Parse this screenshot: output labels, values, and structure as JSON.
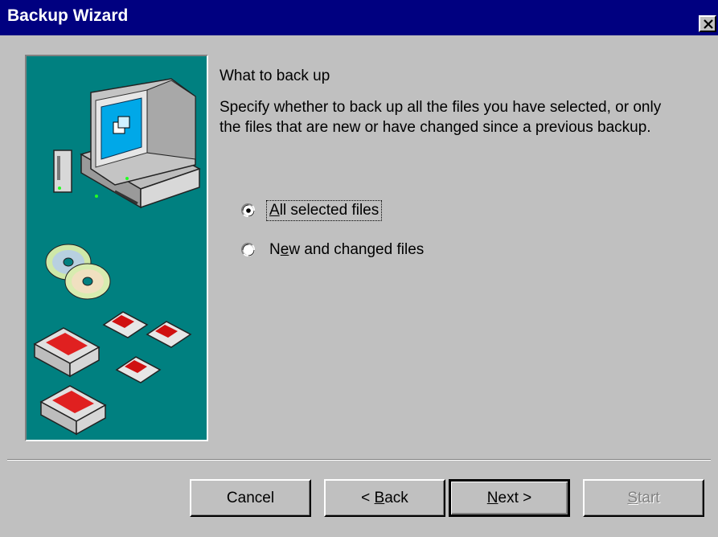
{
  "window": {
    "title": "Backup Wizard",
    "close_icon": "close-x-icon"
  },
  "illustration": {
    "icons": [
      "computer-icon",
      "cd-disc-icon",
      "floppy-disk-icon",
      "tape-cartridge-icon"
    ]
  },
  "content": {
    "heading": "What to back up",
    "description": "Specify whether to back up all the files you have selected, or only the files that are new or have changed since a previous backup."
  },
  "options": {
    "all_selected": {
      "label_ul": "A",
      "label_rest": "ll selected files",
      "checked": true
    },
    "new_changed": {
      "label_pre": "N",
      "label_ul": "e",
      "label_rest": "w and changed files",
      "checked": false
    }
  },
  "buttons": {
    "cancel": "Cancel",
    "back_pre": "< ",
    "back_ul": "B",
    "back_rest": "ack",
    "next_ul": "N",
    "next_rest": "ext >",
    "start_ul": "S",
    "start_rest": "tart"
  },
  "colors": {
    "titlebar": "#000080",
    "face": "#c0c0c0",
    "panel": "#008080"
  }
}
